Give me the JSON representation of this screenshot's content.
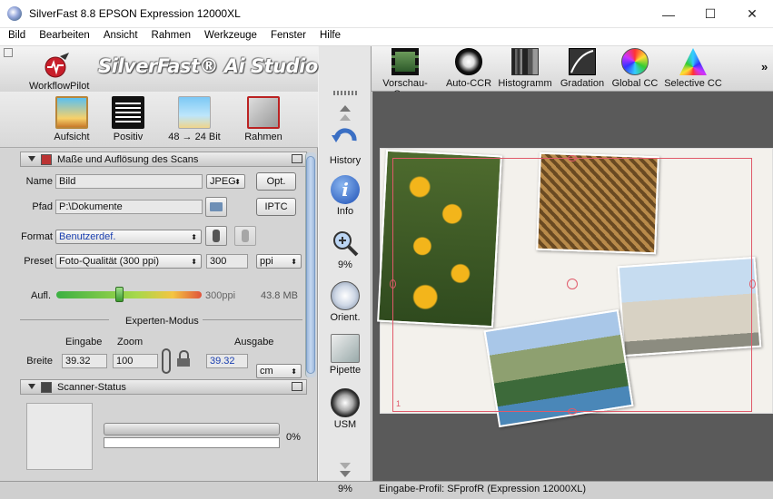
{
  "window": {
    "title": "SilverFast 8.8 EPSON Expression 12000XL",
    "minimize": "—",
    "maximize": "☐",
    "close": "✕"
  },
  "menu": [
    "Bild",
    "Bearbeiten",
    "Ansicht",
    "Rahmen",
    "Werkzeuge",
    "Fenster",
    "Hilfe"
  ],
  "header": {
    "logo": "SilverFast® Ai Studio",
    "workflow_pilot": "WorkflowPilot"
  },
  "tools": {
    "aufsicht": "Aufsicht",
    "positiv": "Positiv",
    "bitdepth": "48 → 24 Bit",
    "rahmen": "Rahmen"
  },
  "scan_section": {
    "title": "Maße und Auflösung des Scans",
    "name_label": "Name",
    "name_value": "Bild",
    "format_select": "JPEG",
    "opt_button": "Opt.",
    "path_label": "Pfad",
    "path_value": "P:\\Dokumente",
    "iptc_button": "IPTC",
    "format_label": "Format",
    "format_value": "Benutzerdef.",
    "preset_label": "Preset",
    "preset_value": "Foto-Qualität (300 ppi)",
    "resolution_value": "300",
    "resolution_unit": "ppi",
    "aufl_label": "Aufl.",
    "aufl_value": "300ppi",
    "filesize": "43.8 MB",
    "aufl_slider_fraction": 0.43,
    "expert_mode": "Experten-Modus",
    "col_input": "Eingabe",
    "col_zoom": "Zoom",
    "col_output": "Ausgabe",
    "width_label": "Breite",
    "width_input": "39.32",
    "zoom_value": "100",
    "width_output": "39.32",
    "unit": "cm"
  },
  "scanner_status": {
    "title": "Scanner-Status",
    "progress_percent": "0%",
    "progress_fraction": 0
  },
  "mid_tools": {
    "history": "History",
    "info": "Info",
    "zoom": "9%",
    "orient": "Orient.",
    "pipette": "Pipette",
    "usm": "USM"
  },
  "top_tools": {
    "preview_scan": "Vorschau-Scan",
    "auto_ccr": "Auto-CCR",
    "histogram": "Histogramm",
    "gradation": "Gradation",
    "global_cc": "Global CC",
    "selective_cc": "Selective CC",
    "more": "»"
  },
  "preview": {
    "frame_number": "1"
  },
  "status": {
    "zoom": "9%",
    "profile": "Eingabe-Profil: SFprofR (Expression 12000XL)"
  },
  "colors": {
    "frame": "#e05a6a",
    "accent_blue": "#1a3fb0",
    "preview_bg": "#5a5a5a"
  }
}
